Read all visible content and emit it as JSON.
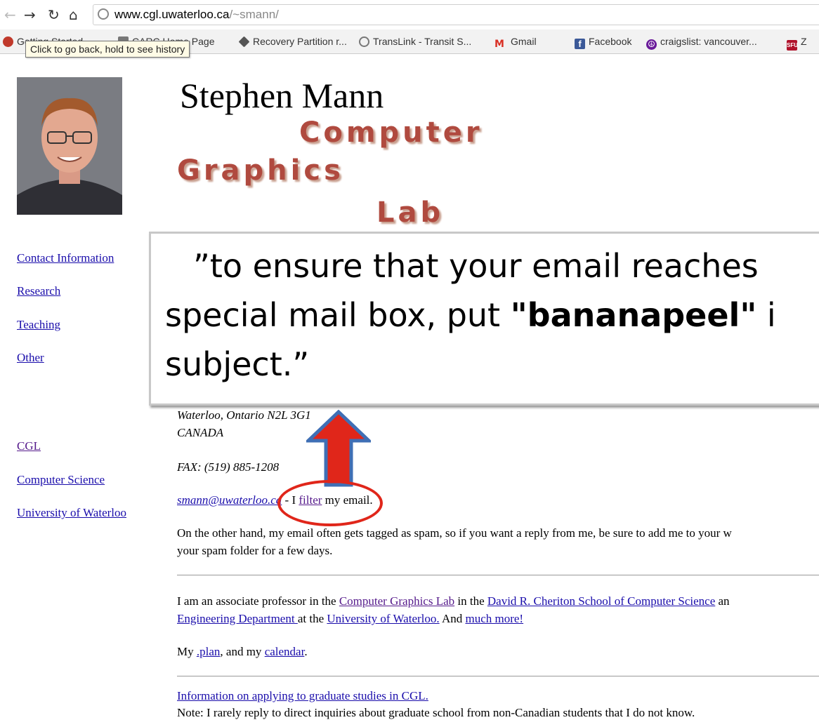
{
  "browser": {
    "url_host": "www.cgl.uwaterloo.ca",
    "url_path": "/~smann/",
    "tooltip": "Click to go back, hold to see history",
    "bookmarks": [
      {
        "label": "Getting Started",
        "icon": "gettingstarted-icon",
        "color": "#c0392b"
      },
      {
        "label": "CARC Home Page",
        "icon": "carc-icon",
        "color": "#555555"
      },
      {
        "label": "Recovery Partition r...",
        "icon": "recovery-icon",
        "color": "#555555"
      },
      {
        "label": "TransLink - Transit S...",
        "icon": "translink-icon",
        "color": "#777777"
      },
      {
        "label": "Gmail",
        "icon": "gmail-icon",
        "color": "#d93025"
      },
      {
        "label": "Facebook",
        "icon": "facebook-icon",
        "color": "#3b5998"
      },
      {
        "label": "craigslist: vancouver...",
        "icon": "peace-icon",
        "color": "#6a1b9a"
      },
      {
        "label": "Z",
        "icon": "sfu-icon",
        "color": "#b0122b"
      }
    ]
  },
  "header": {
    "name": "Stephen Mann",
    "logo": {
      "line1": "Computer",
      "line2": "Graphics",
      "line3": "Lab",
      "color": "#b04a3f"
    }
  },
  "sidebar": {
    "primary": [
      "Contact Information",
      "Research",
      "Teaching",
      "Other"
    ],
    "secondary": [
      "CGL",
      "Computer Science",
      "University of Waterloo"
    ]
  },
  "contact": {
    "address_city": "Waterloo, Ontario N2L 3G1",
    "address_country": "CANADA",
    "fax": "FAX: (519) 885-1208",
    "email": "smann@uwaterloo.ca",
    "email_sep": " - I ",
    "filter_link": "filter",
    "email_tail": " my email.",
    "spam_line1": "On the other hand, my email often gets tagged as spam, so if you want a reply from me, be sure to add me to your w",
    "spam_line2": "your spam folder for a few days."
  },
  "bio": {
    "t1": "I am an associate professor in the ",
    "link_cgl": "Computer Graphics Lab",
    "t2": " in the ",
    "link_cs": "David R. Cheriton School of Computer Science",
    "t3": " an",
    "link_eng": "Engineering Department ",
    "t4": "at the ",
    "link_uw": "University of Waterloo.",
    "t5": " And ",
    "link_more": "much more!"
  },
  "plan": {
    "t1": "My ",
    "link_plan": ".plan",
    "t2": ", and my ",
    "link_calendar": "calendar",
    "t3": "."
  },
  "grad": {
    "link": "Information on applying to graduate studies in CGL. ",
    "note": "Note: I rarely reply to direct inquiries about graduate school from non-Canadian students that I do not know."
  },
  "callout": {
    "line1": "”to ensure that your email reaches",
    "line2_pre": "special mail box, put ",
    "line2_bold": "\"bananapeel\"",
    "line2_post": " i",
    "line3": "subject.”",
    "arrow_color": "#e0261a",
    "circle_color": "#e0261a"
  }
}
